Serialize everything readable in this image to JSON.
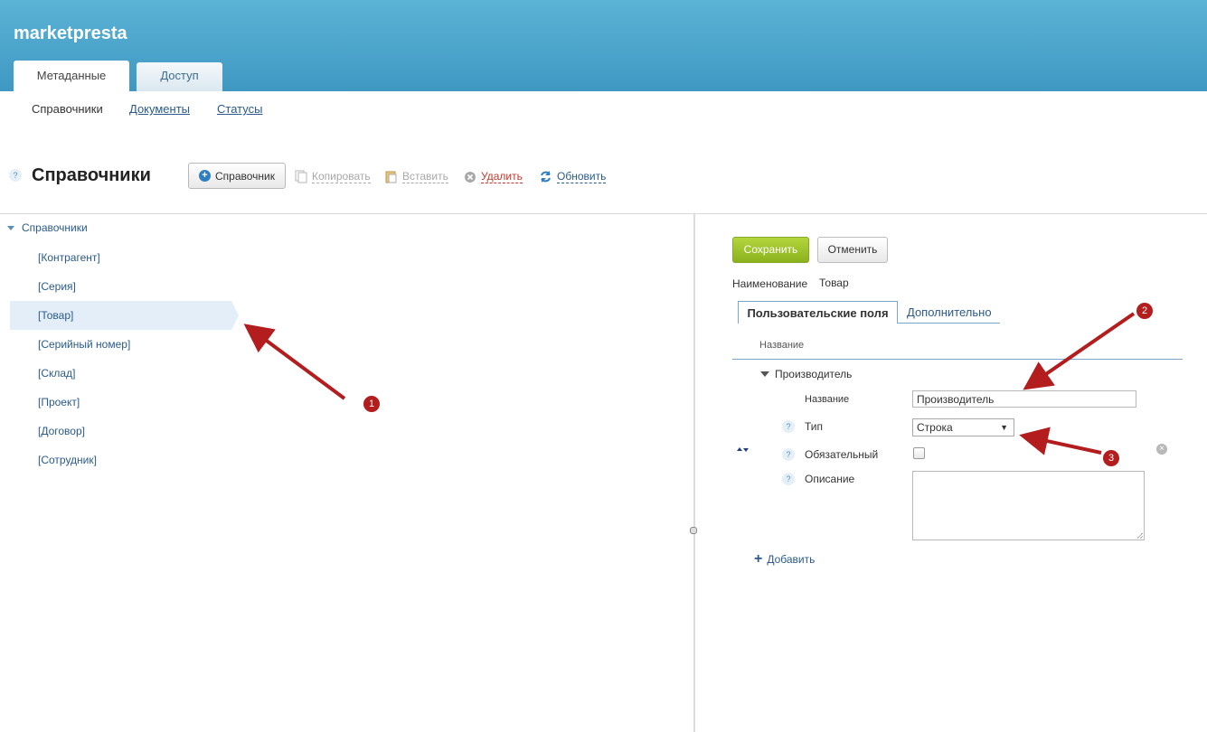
{
  "header": {
    "brand": "marketpresta",
    "tabs": [
      {
        "label": "Метаданные",
        "active": true
      },
      {
        "label": "Доступ",
        "active": false
      }
    ]
  },
  "subnav": [
    {
      "label": "Справочники",
      "current": true
    },
    {
      "label": "Документы",
      "current": false
    },
    {
      "label": "Статусы",
      "current": false
    }
  ],
  "toolbar": {
    "title": "Справочники",
    "help": "?",
    "new_label": "Справочник",
    "copy_label": "Копировать",
    "paste_label": "Вставить",
    "delete_label": "Удалить",
    "refresh_label": "Обновить"
  },
  "tree": {
    "root": "Справочники",
    "items": [
      "[Контрагент]",
      "[Серия]",
      "[Товар]",
      "[Серийный номер]",
      "[Склад]",
      "[Проект]",
      "[Договор]",
      "[Сотрудник]"
    ],
    "selected": "[Товар]"
  },
  "editor": {
    "save_label": "Сохранить",
    "cancel_label": "Отменить",
    "name_label": "Наименование",
    "name_value": "Товар",
    "tabs": [
      "Пользовательские поля",
      "Дополнительно"
    ],
    "column_header": "Название",
    "group": "Производитель",
    "fields": {
      "name_label": "Название",
      "name_value": "Производитель",
      "type_label": "Тип",
      "type_value": "Строка",
      "required_label": "Обязательный",
      "description_label": "Описание"
    },
    "add_label": "Добавить"
  },
  "annotations": [
    "1",
    "2",
    "3"
  ],
  "colors": {
    "header": "#4aa3cc",
    "accent_green": "#9cc12c",
    "link": "#2a5b8a",
    "annotation": "#b31d1d"
  }
}
